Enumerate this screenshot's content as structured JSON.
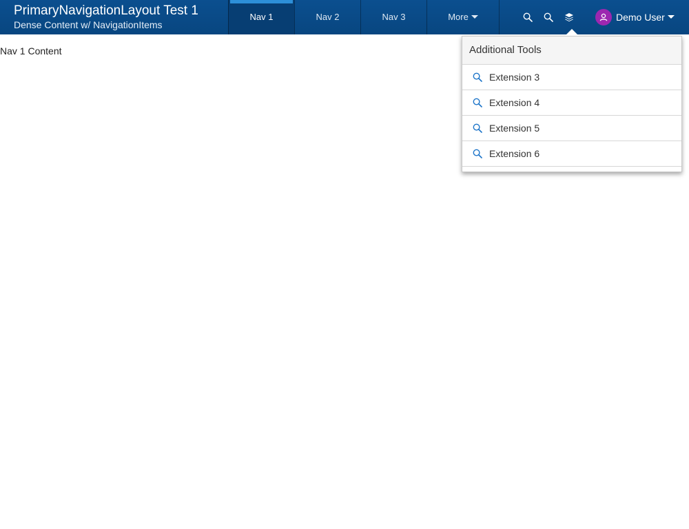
{
  "header": {
    "title": "PrimaryNavigationLayout Test 1",
    "subtitle": "Dense Content w/ NavigationItems"
  },
  "nav": {
    "items": [
      {
        "label": "Nav 1",
        "active": true
      },
      {
        "label": "Nav 2",
        "active": false
      },
      {
        "label": "Nav 3",
        "active": false
      }
    ],
    "more_label": "More"
  },
  "tools": {
    "icons": [
      "search-icon",
      "search-icon",
      "layers-icon"
    ]
  },
  "user": {
    "name": "Demo User",
    "avatar_color": "#9c27b0"
  },
  "content": {
    "label": "Nav 1 Content"
  },
  "popover": {
    "title": "Additional Tools",
    "items": [
      {
        "label": "Extension 3",
        "icon": "search-icon"
      },
      {
        "label": "Extension 4",
        "icon": "search-icon"
      },
      {
        "label": "Extension 5",
        "icon": "search-icon"
      },
      {
        "label": "Extension 6",
        "icon": "search-icon"
      }
    ]
  },
  "colors": {
    "header_bg": "#084680",
    "active_indicator": "#2d8fd8",
    "icon_accent": "#1a73c8"
  }
}
